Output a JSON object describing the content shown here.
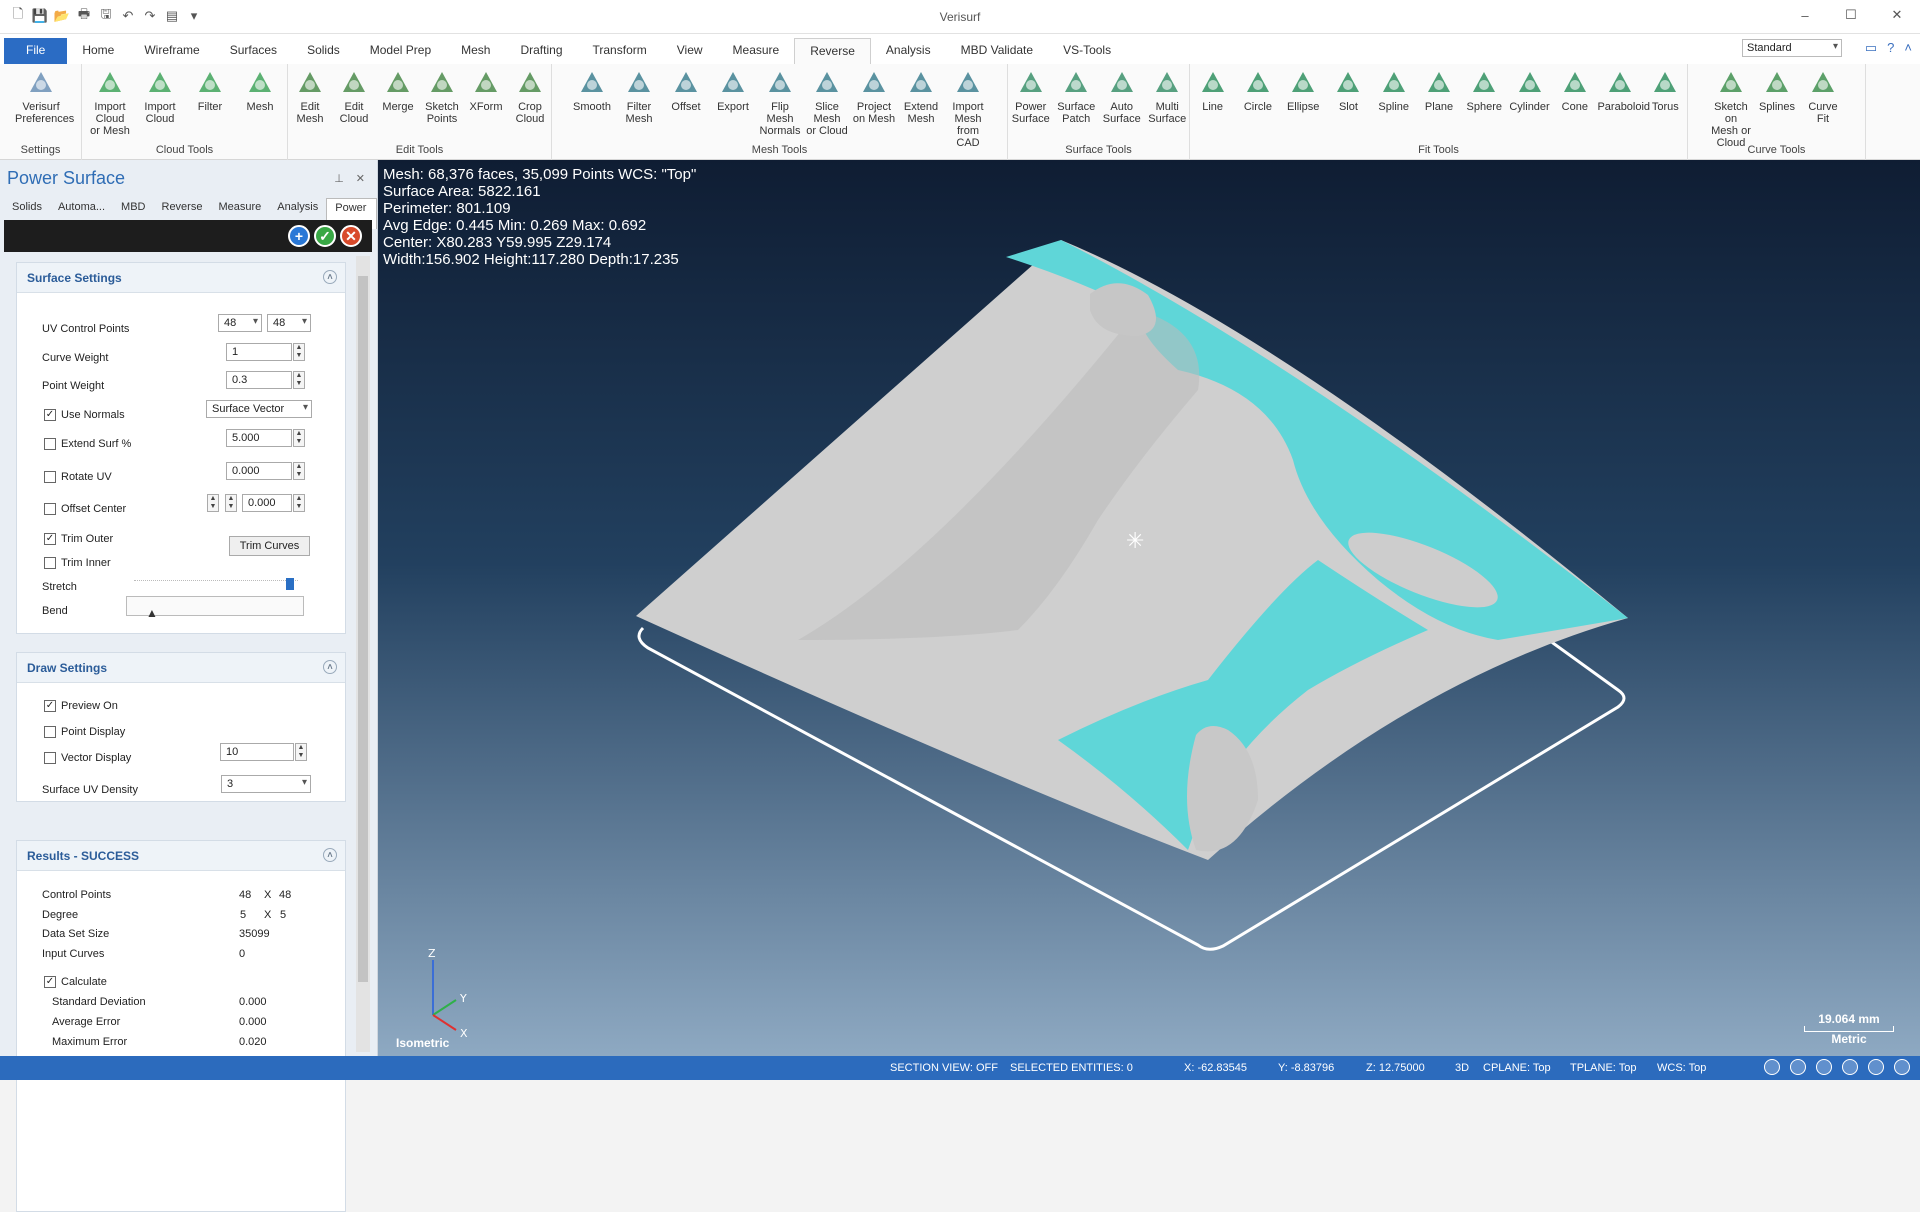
{
  "app": {
    "title": "Verisurf"
  },
  "quick_access": [
    {
      "icon": "new-file-icon",
      "glyph": "🗋"
    },
    {
      "icon": "save-icon",
      "glyph": "💾"
    },
    {
      "icon": "open-icon",
      "glyph": "📂"
    },
    {
      "icon": "print-icon",
      "glyph": "🖶"
    },
    {
      "icon": "save-as-icon",
      "glyph": "🖫"
    },
    {
      "icon": "undo-icon",
      "glyph": "↶"
    },
    {
      "icon": "redo-icon",
      "glyph": "↷"
    },
    {
      "icon": "layout-icon",
      "glyph": "▤"
    },
    {
      "icon": "customize-icon",
      "glyph": "▾"
    }
  ],
  "menu_tabs": [
    "File",
    "Home",
    "Wireframe",
    "Surfaces",
    "Solids",
    "Model Prep",
    "Mesh",
    "Drafting",
    "Transform",
    "View",
    "Measure",
    "Reverse",
    "Analysis",
    "MBD Validate",
    "VS-Tools"
  ],
  "active_tab": "Reverse",
  "workspace": "Standard",
  "ribbon": {
    "settings": {
      "title": "Settings",
      "buttons": [
        {
          "label": "Verisurf\nPreferences"
        }
      ]
    },
    "cloud_tools": {
      "title": "Cloud Tools",
      "buttons": [
        {
          "label": "Import Cloud\nor Mesh"
        },
        {
          "label": "Import\nCloud"
        },
        {
          "label": "Filter"
        },
        {
          "label": "Mesh"
        }
      ]
    },
    "edit_tools": {
      "title": "Edit Tools",
      "buttons": [
        {
          "label": "Edit\nMesh"
        },
        {
          "label": "Edit\nCloud"
        },
        {
          "label": "Merge"
        },
        {
          "label": "Sketch\nPoints"
        },
        {
          "label": "XForm"
        },
        {
          "label": "Crop\nCloud"
        }
      ]
    },
    "mesh_tools": {
      "title": "Mesh Tools",
      "buttons": [
        {
          "label": "Smooth"
        },
        {
          "label": "Filter\nMesh"
        },
        {
          "label": "Offset"
        },
        {
          "label": "Export"
        },
        {
          "label": "Flip Mesh\nNormals"
        },
        {
          "label": "Slice Mesh\nor Cloud"
        },
        {
          "label": "Project\non Mesh"
        },
        {
          "label": "Extend\nMesh"
        },
        {
          "label": "Import Mesh\nfrom CAD"
        }
      ]
    },
    "surface_tools": {
      "title": "Surface Tools",
      "buttons": [
        {
          "label": "Power\nSurface"
        },
        {
          "label": "Surface\nPatch"
        },
        {
          "label": "Auto\nSurface"
        },
        {
          "label": "Multi\nSurface"
        }
      ]
    },
    "fit_tools": {
      "title": "Fit Tools",
      "buttons": [
        {
          "label": "Line"
        },
        {
          "label": "Circle"
        },
        {
          "label": "Ellipse"
        },
        {
          "label": "Slot"
        },
        {
          "label": "Spline"
        },
        {
          "label": "Plane"
        },
        {
          "label": "Sphere"
        },
        {
          "label": "Cylinder"
        },
        {
          "label": "Cone"
        },
        {
          "label": "Paraboloid"
        },
        {
          "label": "Torus"
        }
      ]
    },
    "curve_tools": {
      "title": "Curve Tools",
      "buttons": [
        {
          "label": "Sketch on\nMesh or Cloud"
        },
        {
          "label": "Splines"
        },
        {
          "label": "Curve\nFit"
        }
      ]
    }
  },
  "panel": {
    "title": "Power Surface",
    "tabs": [
      "Solids",
      "Automa...",
      "MBD",
      "Reverse",
      "Measure",
      "Analysis",
      "Power ..."
    ],
    "surface_settings": {
      "title": "Surface Settings",
      "uv_label": "UV Control Points",
      "u_value": "48",
      "v_value": "48",
      "curve_weight_label": "Curve Weight",
      "curve_weight": "1",
      "point_weight_label": "Point Weight",
      "point_weight": "0.3",
      "use_normals_label": "Use Normals",
      "use_normals_checked": true,
      "normals_mode": "Surface Vector",
      "extend_label": "Extend Surf %",
      "extend_checked": false,
      "extend_value": "5.000",
      "rotate_label": "Rotate UV",
      "rotate_checked": false,
      "rotate_value": "0.000",
      "offset_label": "Offset Center",
      "offset_checked": false,
      "offset_value": "0.000",
      "trim_outer_label": "Trim Outer",
      "trim_outer_checked": true,
      "trim_inner_label": "Trim Inner",
      "trim_inner_checked": false,
      "trim_curves_label": "Trim Curves",
      "stretch_label": "Stretch",
      "stretch_level": 1.0,
      "bend_label": "Bend",
      "bend_level": 0.0
    },
    "draw_settings": {
      "title": "Draw Settings",
      "preview_label": "Preview On",
      "preview_checked": true,
      "point_display_label": "Point Display",
      "point_display_checked": false,
      "vector_display_label": "Vector Display",
      "vector_display_checked": false,
      "vector_value": "10",
      "density_label": "Surface UV Density",
      "density_value": "3"
    },
    "results": {
      "title": "Results - SUCCESS",
      "control_points_label": "Control Points",
      "cp_u": "48",
      "cp_x": "X",
      "cp_v": "48",
      "degree_label": "Degree",
      "deg_u": "5",
      "deg_x": "X",
      "deg_v": "5",
      "data_set_label": "Data Set Size",
      "data_set": "35099",
      "input_curves_label": "Input Curves",
      "input_curves": "0",
      "calculate_label": "Calculate",
      "calculate_checked": true,
      "std_dev_label": "Standard Deviation",
      "std_dev": "0.000",
      "avg_err_label": "Average Error",
      "avg_err": "0.000",
      "max_err_label": "Maximum Error",
      "max_err": "0.020"
    }
  },
  "viewport": {
    "info_lines": [
      "Mesh: 68,376 faces, 35,099 Points  WCS: \"Top\"",
      "Surface Area: 5822.161",
      "Perimeter: 801.109",
      "Avg Edge: 0.445 Min: 0.269 Max: 0.692",
      "Center: X80.283 Y59.995 Z29.174",
      "Width:156.902 Height:117.280 Depth:17.235"
    ],
    "view_name": "Isometric",
    "scale_value": "19.064 mm",
    "scale_unit": "Metric",
    "axis_labels": {
      "z": "Z",
      "y": "Y",
      "x": "X"
    },
    "colors": {
      "surface": "#cfcfcf",
      "highlight": "#5fd6d8",
      "frame": "#ffffff"
    }
  },
  "status": {
    "section_view": "SECTION VIEW: OFF",
    "selected": "SELECTED ENTITIES: 0",
    "x": "X:  -62.83545",
    "y": "Y:  -8.83796",
    "z": "Z:  12.75000",
    "mode": "3D",
    "cplane": "CPLANE: Top",
    "tplane": "TPLANE: Top",
    "wcs": "WCS: Top"
  }
}
